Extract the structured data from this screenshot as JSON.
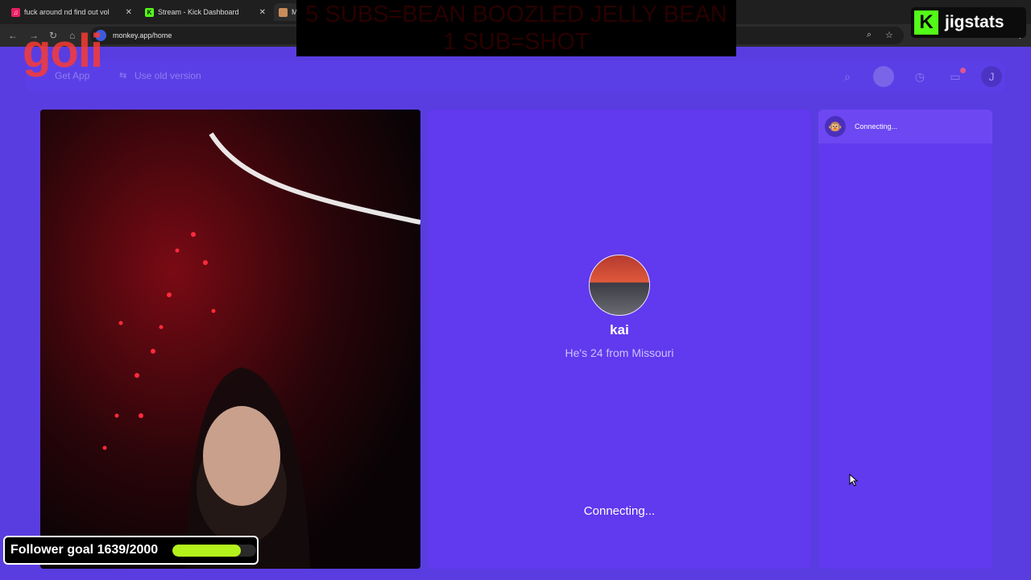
{
  "browser": {
    "tabs": [
      {
        "label": "fuck around nd find out vol",
        "favicon": "music-icon"
      },
      {
        "label": "Stream - Kick Dashboard",
        "favicon": "kick-icon"
      },
      {
        "label": "M",
        "favicon": "monkey-icon"
      }
    ],
    "url": "monkey.app/home"
  },
  "overlay": {
    "banner_line1": "5 SUBS=BEAN BOOZLED JELLY BEAN",
    "banner_line2": "1 SUB=SHOT",
    "kick_letter": "K",
    "kick_name": "jigstats",
    "watermark": "goli"
  },
  "header": {
    "get_app": "Get App",
    "old_version": "Use old version",
    "user_initial": "J"
  },
  "match": {
    "name": "kai",
    "description": "He's 24 from Missouri",
    "status": "Connecting..."
  },
  "chat": {
    "status": "Connecting..."
  },
  "goal": {
    "label": "Follower goal 1639/2000",
    "current": 1639,
    "target": 2000
  },
  "colors": {
    "page_bg": "#5a3de0",
    "panel_bg": "#6139ee",
    "goal_fill": "#b4f21c",
    "kick_green": "#53fc18"
  }
}
